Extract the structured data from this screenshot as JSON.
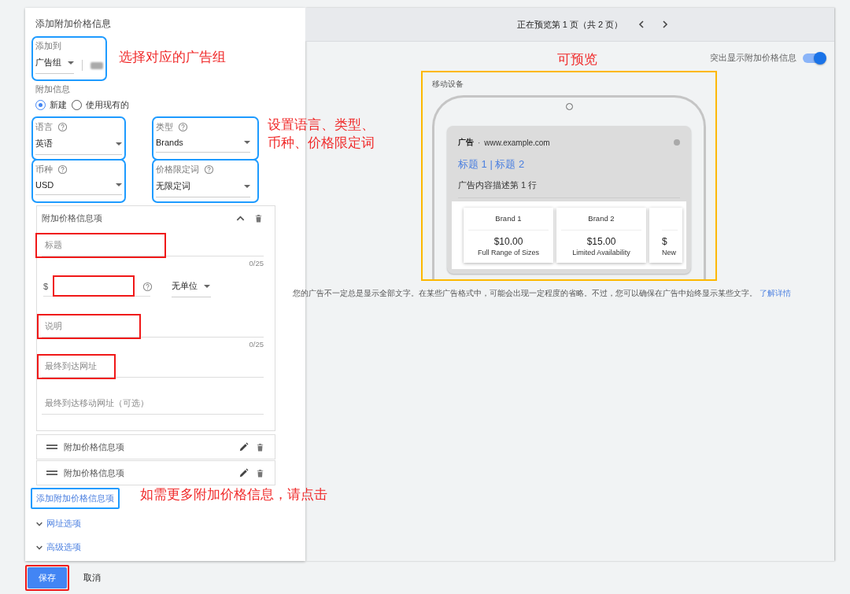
{
  "panel_title": "添加附加价格信息",
  "add_to": {
    "label": "添加到",
    "value": "广告组",
    "highlighted": true
  },
  "extension": {
    "label": "附加信息",
    "options": [
      {
        "label": "新建",
        "selected": true
      },
      {
        "label": "使用现有的",
        "selected": false
      }
    ]
  },
  "settings": [
    {
      "label": "语言",
      "value": "英语",
      "highlighted": true
    },
    {
      "label": "类型",
      "value": "Brands",
      "highlighted": true
    },
    {
      "label": "币种",
      "value": "USD",
      "highlighted": true
    },
    {
      "label": "价格限定词",
      "value": "无限定词",
      "highlighted": true
    }
  ],
  "price_item": {
    "title": "附加价格信息项",
    "expanded": true,
    "headline": {
      "placeholder": "标题",
      "counter": "0/25",
      "highlighted": true
    },
    "price": {
      "currency_symbol": "$",
      "highlighted": true,
      "unit": "无单位"
    },
    "description": {
      "placeholder": "说明",
      "counter": "0/25",
      "highlighted": true
    },
    "final_url": {
      "placeholder": "最终到达网址",
      "highlighted": true
    },
    "mobile_url": {
      "placeholder": "最终到达移动网址（可选）"
    }
  },
  "collapsed_items": [
    {
      "title": "附加价格信息项"
    },
    {
      "title": "附加价格信息项"
    }
  ],
  "add_item_link": {
    "label": "添加附加价格信息项",
    "highlighted": true
  },
  "sections": [
    {
      "label": "网址选项",
      "expanded": false
    },
    {
      "label": "高级选项",
      "expanded": false
    }
  ],
  "footer": {
    "save": {
      "label": "保存",
      "highlighted": true
    },
    "cancel": "取消"
  },
  "preview": {
    "pager": "正在预览第 1 页（共 2 页）",
    "highlight_toggle": {
      "label": "突出显示附加价格信息",
      "on": true
    },
    "device": {
      "label": "移动设备",
      "highlighted": true
    },
    "ad": {
      "badge": "广告",
      "separator": "·",
      "url": "www.example.com",
      "headline": "标题 1 | 标题 2",
      "description": "广告内容描述第 1 行",
      "items": [
        {
          "kind": "full",
          "header": "Brand 1",
          "price": "$10.00",
          "description": "Full Range of Sizes"
        },
        {
          "kind": "full",
          "header": "Brand 2",
          "price": "$15.00",
          "description": "Limited Availability"
        },
        {
          "kind": "partial",
          "price": "$",
          "description": "New"
        }
      ]
    },
    "notice": "您的广告不一定总是显示全部文字。在某些广告格式中，可能会出现一定程度的省略。不过，您可以确保在广告中始终显示某些文字。",
    "notice_link": "了解详情"
  },
  "annotations": [
    {
      "text": "选择对应的广告组"
    },
    {
      "text": "设置语言、类型、币种、价格限定词"
    },
    {
      "text": "可预览"
    },
    {
      "text": "如需更多附加价格信息，请点击"
    }
  ]
}
